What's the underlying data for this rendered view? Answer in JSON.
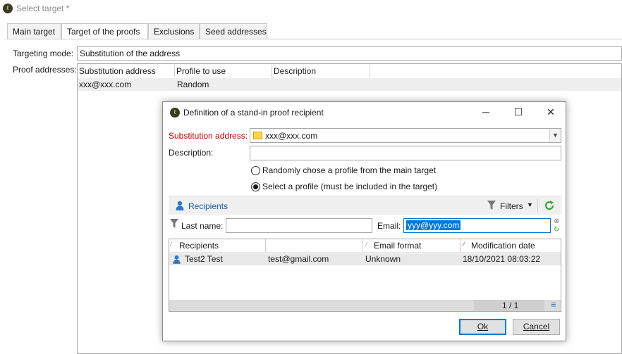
{
  "window": {
    "title": "Select target *"
  },
  "tabs": [
    {
      "label": "Main target"
    },
    {
      "label": "Target of the proofs"
    },
    {
      "label": "Exclusions"
    },
    {
      "label": "Seed addresses"
    }
  ],
  "targeting": {
    "mode_label": "Targeting mode:",
    "mode_value": "Substitution of the address"
  },
  "proof": {
    "label": "Proof addresses:",
    "columns": [
      "Substitution address",
      "Profile to use",
      "Description"
    ],
    "rows": [
      {
        "address": "xxx@xxx.com",
        "profile": "Random",
        "description": ""
      }
    ]
  },
  "dialog": {
    "title": "Definition of a stand-in proof recipient",
    "substitution_label": "Substitution address:",
    "substitution_value": "xxx@xxx.com",
    "description_label": "Description:",
    "description_value": "",
    "radio_random": "Randomly chose a profile from the main target",
    "radio_select": "Select a profile (must be included in the target)",
    "selected_radio": "select",
    "recipients_label": "Recipients",
    "filters_label": "Filters",
    "lastname_label": "Last name:",
    "lastname_value": "",
    "email_label": "Email:",
    "email_value": "yyy@yyy.com",
    "list_columns": [
      "Recipients",
      "",
      "Email format",
      "Modification date"
    ],
    "list_rows": [
      {
        "name": "Test2 Test",
        "email": "test@gmail.com",
        "format": "Unknown",
        "modified": "18/10/2021 08:03:22"
      }
    ],
    "pager": "1 / 1",
    "ok_label": "Ok",
    "cancel_label": "Cancel"
  },
  "colors": {
    "accent": "#0078d7",
    "required": "#c00000",
    "link": "#1f5fa8",
    "refresh": "#3aa635"
  }
}
